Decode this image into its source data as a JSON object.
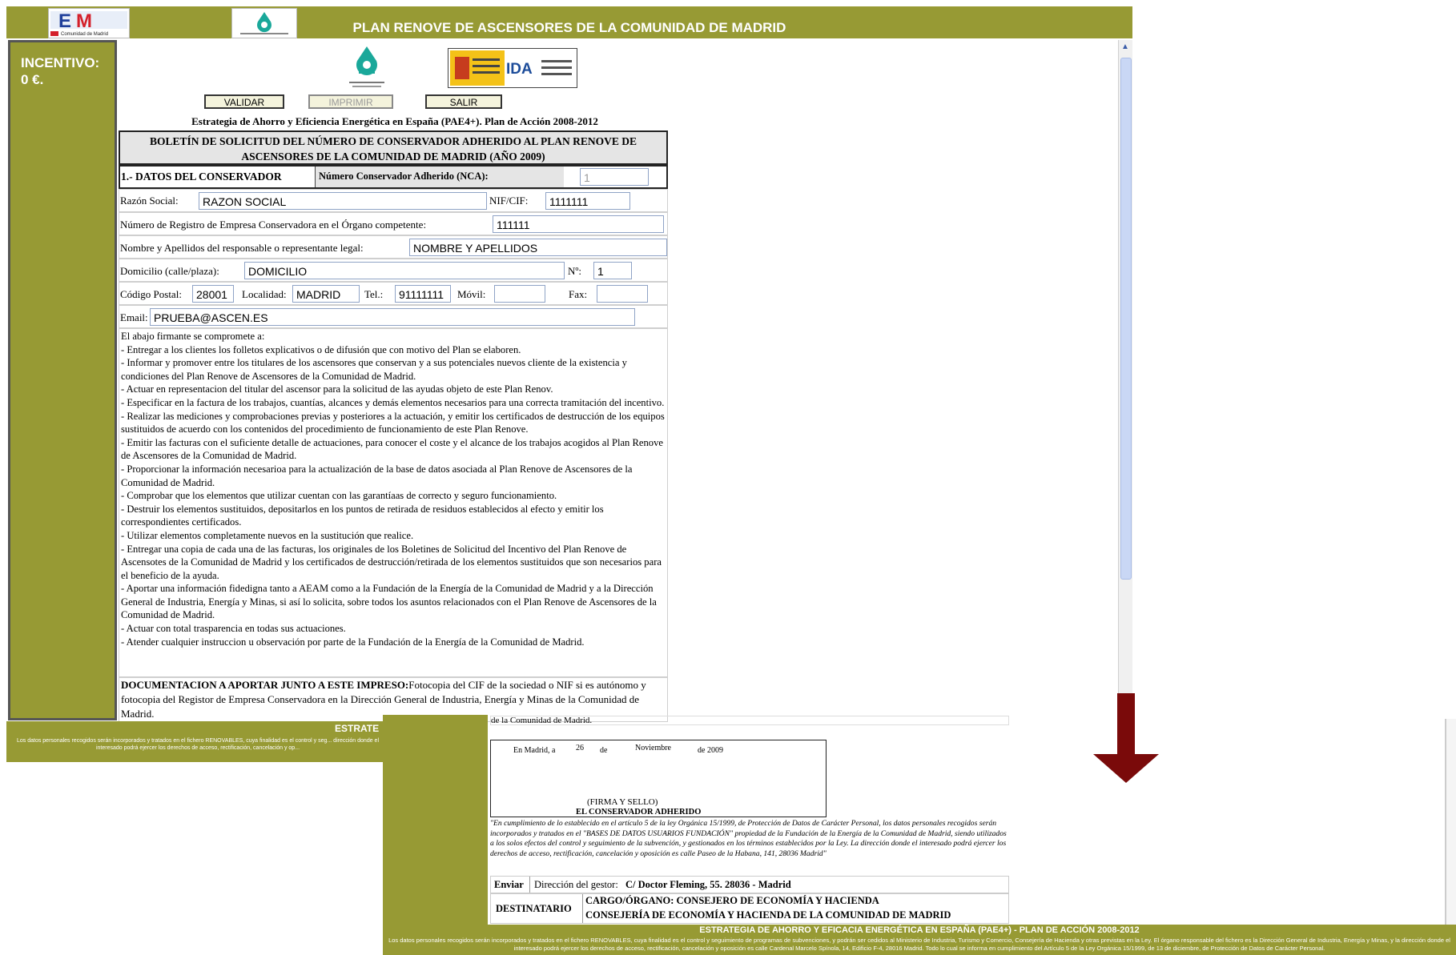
{
  "app": {
    "title": "PLAN RENOVE DE ASCENSORES DE LA COMUNIDAD DE MADRID",
    "logo_left_text": "Comunidad de Madrid",
    "incentive_label": "INCENTIVO:",
    "incentive_value": "0 €."
  },
  "buttons": {
    "validar": "VALIDAR",
    "imprimir": "IMPRIMIR",
    "salir": "SALIR"
  },
  "form": {
    "strategy_title": "Estrategia de Ahorro y Eficiencia Energética en España (PAE4+). Plan de Acción 2008-2012",
    "heading": "BOLETÍN DE SOLICITUD DEL NÚMERO DE CONSERVADOR ADHERIDO AL PLAN RENOVE DE ASCENSORES DE LA COMUNIDAD DE MADRID (AÑO 2009)",
    "section1": "1.- DATOS DEL CONSERVADOR",
    "nca_label": "Número Conservador Adherido (NCA):",
    "nca_value": "1",
    "razon_label": "Razón Social:",
    "razon_value": "RAZON SOCIAL",
    "nif_label": "NIF/CIF:",
    "nif_value": "1111111",
    "registro_label": "Número de Registro de Empresa Conservadora en el Órgano competente:",
    "registro_value": "111111",
    "nombre_label": "Nombre y Apellidos del responsable o representante legal:",
    "nombre_value": "NOMBRE Y APELLIDOS",
    "domicilio_label": "Domicilio (calle/plaza):",
    "domicilio_value": "DOMICILIO",
    "numero_label": "Nº:",
    "numero_value": "1",
    "cp_label": "Código Postal:",
    "cp_value": "28001",
    "localidad_label": "Localidad:",
    "localidad_value": "MADRID",
    "tel_label": "Tel.:",
    "tel_value": "91111111",
    "movil_label": "Móvil:",
    "movil_value": "",
    "fax_label": "Fax:",
    "fax_value": "",
    "email_label": "Email:",
    "email_value": "PRUEBA@ASCEN.ES",
    "commitments": [
      "El abajo firmante se compromete a:",
      "- Entregar a los clientes los folletos explicativos o de difusión que con motivo del Plan se elaboren.",
      "- Informar y promover entre los titulares de los ascensores que conservan y a sus potenciales nuevos cliente de la existencia y condiciones del Plan Renove de Ascensores de la Comunidad de Madrid.",
      "- Actuar en representacion del titular del ascensor para la solicitud de las ayudas objeto de este Plan Renov.",
      "- Especificar en la factura de los trabajos, cuantías, alcances y demás elementos necesarios para una correcta tramitación del incentivo.",
      "- Realizar las mediciones y comprobaciones previas y posteriores a la actuación, y emitir los certificados de destrucción de los equipos sustituidos de acuerdo con los contenidos del procedimiento de funcionamiento de este Plan Renove.",
      "- Emitir las facturas con el suficiente detalle de actuaciones, para conocer el coste y el alcance de los trabajos acogidos al Plan Renove de Ascensores de la Comunidad de Madrid.",
      "- Proporcionar la información necesarioa para la actualización de la base de datos asociada al Plan Renove de Ascensores de la Comunidad de Madrid.",
      "- Comprobar que los elementos que utilizar cuentan con las garantíaas de correcto y seguro funcionamiento.",
      "- Destruir los elementos sustituidos, depositarlos en los puntos de retirada de residuos establecidos al efecto y emitir los correspondientes certificados.",
      "- Utilizar elementos completamente nuevos en la sustitución que realice.",
      "- Entregar una copia de cada una de las facturas, los originales de los Boletines de Solicitud del Incentivo del Plan Renove de Ascensotes de la Comunidad de Madrid y los certificados de destrucción/retirada de los elementos sustituidos que son necesarios para el beneficio de la ayuda.",
      "- Aportar una información fidedigna tanto a AEAM como a la Fundación de la Energía de la Comunidad de Madrid y a la Dirección General de Industria, Energía y Minas, si así lo solicita, sobre todos los asuntos relacionados con el Plan Renove de Ascensores de la Comunidad de Madrid.",
      "- Actuar con total trasparencia en todas sus actuaciones.",
      "- Atender cualquier instruccion u observación por parte de la Fundación de la Energía de la Comunidad de Madrid."
    ],
    "doc_label": "DOCUMENTACION A APORTAR JUNTO A ESTE IMPRESO:",
    "doc_text": "Fotocopia del CIF de la sociedad o NIF si es autónomo y fotocopia del Registor de Empresa Conservadora en la Dirección General de Industria, Energía y Minas de la Comunidad de Madrid."
  },
  "footer1": {
    "band_title": "ESTRATE",
    "band_text": "Los datos personales recogidos serán incorporados y tratados en el fichero RENOVABLES, cuya finalidad es el control y seg... dirección donde el interesado podrá ejercer los derechos de acceso, rectificación, cancelación y op..."
  },
  "second": {
    "continued_text": "de la Comunidad de Madrid.",
    "place": "En Madrid, a",
    "day": "26",
    "de1": "de",
    "month": "Noviembre",
    "year": "de 2009",
    "firma": "(FIRMA Y SELLO)",
    "conservador": "EL CONSERVADOR ADHERIDO",
    "legal": "\"En cumplimiento de lo establecido en el artículo 5 de la ley Orgánica 15/1999, de Protección de Datos de Carácter Personal, los datos personales recogidos serán incorporados y tratados en el \"BASES DE DATOS USUARIOS FUNDACIÓN\" propiedad de la Fundación de la Energía de la Comunidad de Madrid, siendo utilizados a los solos efectos del control y seguimiento de la subvención, y gestionados en los términos establecidos por la Ley. La dirección donde el interesado podrá ejercer los derechos de acceso, rectificación, cancelación y oposición es calle Paseo de la Habana, 141, 28036 Madrid\"",
    "enviar": "Enviar",
    "direccion_label": "Dirección del gestor:",
    "direccion_value": "C/ Doctor Fleming, 55. 28036 - Madrid",
    "destinatario": "DESTINATARIO",
    "cargo": "CARGO/ÓRGANO: CONSEJERO DE ECONOMÍA Y HACIENDA",
    "consejeria": "CONSEJERÍA DE ECONOMÍA Y HACIENDA DE LA COMUNIDAD DE MADRID",
    "footer_title": "ESTRATEGIA DE AHORRO Y EFICACIA ENERGÉTICA EN ESPAÑA (PAE4+)  - PLAN DE ACCIÓN 2008-2012",
    "footer_text": "Los datos personales recogidos serán incorporados y tratados en el fichero RENOVABLES, cuya finalidad es el control y seguimiento de programas de subvenciones, y podrán ser cedidos al Ministerio de Industria, Turismo y Comercio, Consejería de Hacienda y otras previstas en la Ley. El órgano responsable del fichero es la Dirección General de Industria, Energía y Minas, y la dirección donde el interesado podrá ejercer los derechos de acceso, rectificación, cancelación y oposición es calle Cardenal Marcelo Spínola, 14, Edificio F-4, 28016 Madrid. Todo lo cual se informa en cumplimiento del Artículo 5 de la Ley Orgánica 15/1999, de 13 de diciembre, de Protección de Datos de Carácter Personal."
  },
  "colors": {
    "olive": "#979a34",
    "arrow": "#7a0a0a"
  }
}
